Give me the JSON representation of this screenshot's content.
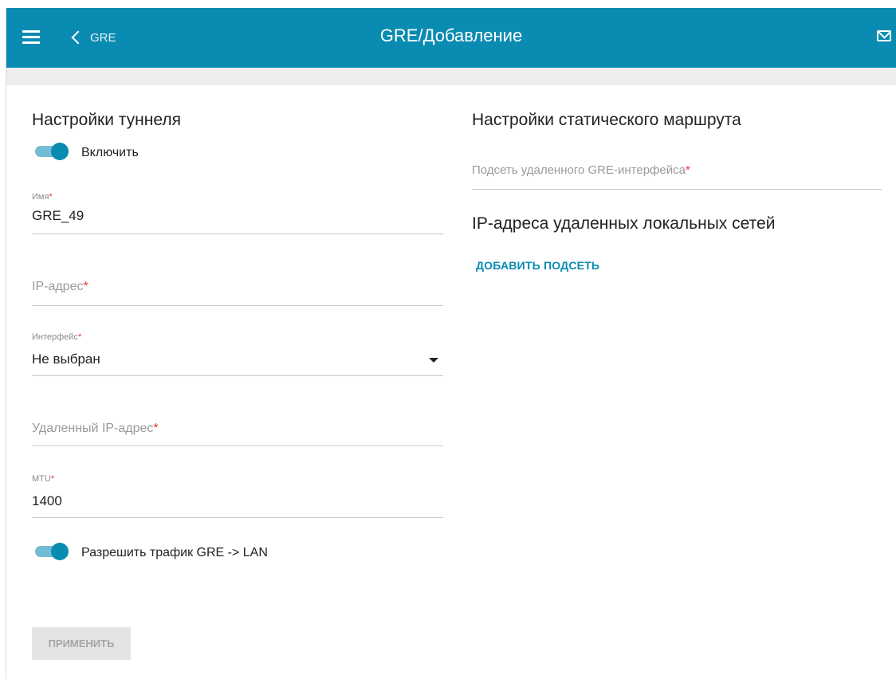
{
  "header": {
    "back_label": "GRE",
    "title": "GRE/Добавление",
    "menu_icon": "menu-icon",
    "mail_icon": "mail-icon",
    "bar_color": "#0a8bb1"
  },
  "tunnel": {
    "title": "Настройки туннеля",
    "enable_label": "Включить",
    "enable_on": true,
    "name_label": "Имя",
    "name_value": "GRE_49",
    "ip_placeholder": "IP-адрес",
    "interface_label": "Интерфейс",
    "interface_value": "Не выбран",
    "remote_ip_placeholder": "Удаленный IP-адрес",
    "mtu_label": "MTU",
    "mtu_value": "1400",
    "allow_traffic_label": "Разрешить трафик GRE -> LAN",
    "allow_traffic_on": true
  },
  "static_route": {
    "title": "Настройки статического маршрута",
    "subnet_placeholder": "Подсеть удаленного GRE-интерфейса",
    "remote_nets_title": "IP-адреса удаленных локальных сетей",
    "add_subnet_label": "ДОБАВИТЬ ПОДСЕТЬ"
  },
  "apply_label": "ПРИМЕНИТЬ",
  "required_mark": "*"
}
